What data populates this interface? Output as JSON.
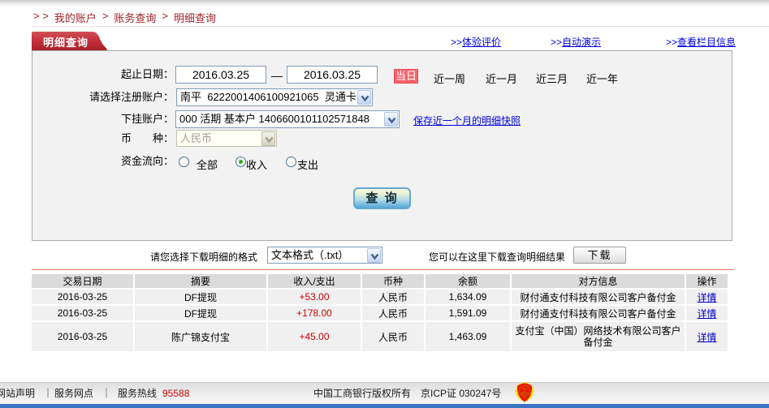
{
  "breadcrumb": {
    "prefix": "> >",
    "separator": ">",
    "items": [
      "我的账户",
      "账务查询",
      "明细查询"
    ]
  },
  "tab_title": "明细查询",
  "top_links": {
    "arrows": ">>",
    "items": [
      "体验评价",
      "自动演示",
      "查看栏目信息"
    ]
  },
  "form": {
    "date_label": "起止日期：",
    "date_from": "2016.03.25",
    "date_dash": "—",
    "date_to": "2016.03.25",
    "today_button": "当日",
    "quick_ranges": [
      "近一周",
      "近一月",
      "近三月",
      "近一年"
    ],
    "account_label": "请选择注册账户：",
    "account_value": "南平  6222001406100921065  灵通卡",
    "sub_account_label": "下挂账户：",
    "sub_account_value": "000 活期 基本户 1406600101102571848",
    "snapshot_link": "保存近一个月的明细快照",
    "currency_label": "币　　种：",
    "currency_value": "人民币",
    "flow_label": "资金流向：",
    "flow_options": [
      {
        "label": "全部",
        "selected": false
      },
      {
        "label": "收入",
        "selected": true
      },
      {
        "label": "支出",
        "selected": false
      }
    ],
    "query_button": "查 询"
  },
  "download": {
    "format_label": "请您选择下载明细的格式",
    "format_value": "文本格式（.txt）",
    "hint_label": "您可以在这里下载查询明细结果",
    "button": "下载"
  },
  "table": {
    "columns": [
      "交易日期",
      "摘要",
      "收入/支出",
      "币种",
      "余额",
      "对方信息",
      "操作"
    ],
    "rows": [
      {
        "date": "2016-03-25",
        "summary": "DF提现",
        "amount": "+53.00",
        "currency": "人民币",
        "balance": "1,634.09",
        "counterparty": "财付通支付科技有限公司客户备付金",
        "action": "详情"
      },
      {
        "date": "2016-03-25",
        "summary": "DF提现",
        "amount": "+178.00",
        "currency": "人民币",
        "balance": "1,591.09",
        "counterparty": "财付通支付科技有限公司客户备付金",
        "action": "详情"
      },
      {
        "date": "2016-03-25",
        "summary": "陈广锦支付宝",
        "amount": "+45.00",
        "currency": "人民币",
        "balance": "1,463.09",
        "counterparty": "支付宝（中国）网络技术有限公司客户备付金",
        "action": "详情"
      }
    ]
  },
  "footer": {
    "link_1": "网站声明",
    "separator": "｜",
    "link_2": "服务网点",
    "hotline_label": "服务热线",
    "hotline_number": "95588",
    "copyright": "中国工商银行版权所有",
    "icp": "京ICP证 030247号"
  },
  "colors": {
    "tab_red": "#c22f39",
    "today_red": "#f96a6a",
    "link_blue": "#0000dd",
    "amount_red": "#cc0000",
    "footer_blue_bar": "#3a75c4"
  }
}
